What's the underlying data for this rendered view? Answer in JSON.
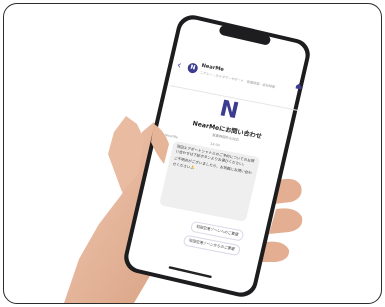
{
  "screen": {
    "app_name": "NearMe",
    "app_subtitle": "ニアミー・カスタマーサポート　営業時間・返信時間",
    "logo_letter": "N",
    "title": "NearMeにお問い合わせ",
    "subtitle": "営業時間外も対応",
    "sender": "NearMe",
    "time": "14:00",
    "message_p1": "羽田エアポートシャトルのご予約についてのお問い合わせは下記ボタンよりお選びください。",
    "message_p2": "ご不明点がございましたら、お気軽にお問い合わせください🙏",
    "chip_1": "羽田空港ゾーンへのご要望",
    "chip_2": "羽田空港ゾーンからのご要望"
  },
  "colors": {
    "accent": "#3b3b8f",
    "bubble": "#efefef",
    "skin": "#e5b79d",
    "phone_body": "#1d1d1f"
  }
}
